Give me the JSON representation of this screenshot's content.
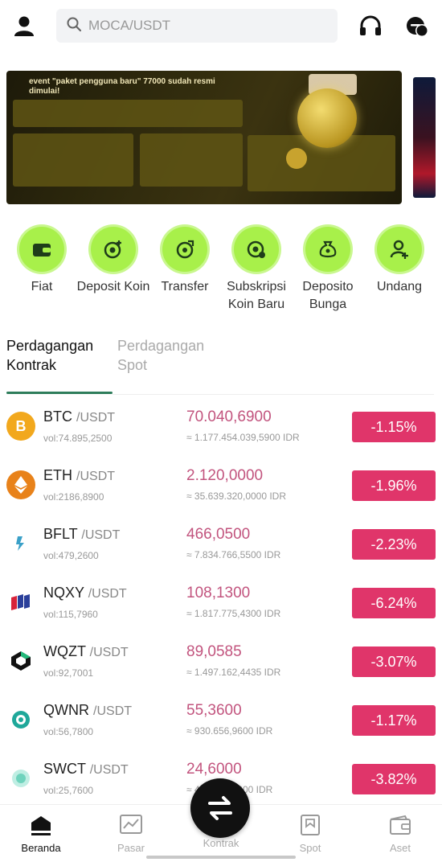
{
  "search": {
    "placeholder": "MOCA/USDT"
  },
  "banner": {
    "title": "event \"paket pengguna baru\" 77000 sudah resmi dimulai!"
  },
  "quick_actions": [
    {
      "label": "Fiat",
      "icon": "wallet-icon"
    },
    {
      "label": "Deposit Koin",
      "icon": "coin-deposit-icon"
    },
    {
      "label": "Transfer",
      "icon": "transfer-icon"
    },
    {
      "label": "Subskripsi Koin Baru",
      "icon": "subscribe-icon"
    },
    {
      "label": "Deposito Bunga",
      "icon": "money-bag-icon"
    },
    {
      "label": "Undang",
      "icon": "invite-user-icon"
    }
  ],
  "tabs": {
    "active": "Perdagangan Kontrak",
    "inactive": "Perdagangan Spot"
  },
  "markets": [
    {
      "base": "BTC",
      "quote": "/USDT",
      "vol": "vol:74.895,2500",
      "price": "70.040,6900",
      "idr": "≈ 1.177.454.039,5900 IDR",
      "change": "-1.15%",
      "icon_color": "#f2a81d",
      "icon_text": "B"
    },
    {
      "base": "ETH",
      "quote": "/USDT",
      "vol": "vol:2186,8900",
      "price": "2.120,0000",
      "idr": "≈ 35.639.320,0000 IDR",
      "change": "-1.96%",
      "icon_color": "#e8821a",
      "icon_text": "◆"
    },
    {
      "base": "BFLT",
      "quote": "/USDT",
      "vol": "vol:479,2600",
      "price": "466,0500",
      "idr": "≈ 7.834.766,5500 IDR",
      "change": "-2.23%",
      "icon_color": "#ffffff",
      "icon_text": ""
    },
    {
      "base": "NQXY",
      "quote": "/USDT",
      "vol": "vol:115,7960",
      "price": "108,1300",
      "idr": "≈ 1.817.775,4300 IDR",
      "change": "-6.24%",
      "icon_color": "#ffffff",
      "icon_text": ""
    },
    {
      "base": "WQZT",
      "quote": "/USDT",
      "vol": "vol:92,7001",
      "price": "89,0585",
      "idr": "≈ 1.497.162,4435 IDR",
      "change": "-3.07%",
      "icon_color": "#ffffff",
      "icon_text": ""
    },
    {
      "base": "QWNR",
      "quote": "/USDT",
      "vol": "vol:56,7800",
      "price": "55,3600",
      "idr": "≈ 930.656,9600 IDR",
      "change": "-1.17%",
      "icon_color": "#ffffff",
      "icon_text": ""
    },
    {
      "base": "SWCT",
      "quote": "/USDT",
      "vol": "vol:25,7600",
      "price": "24,6000",
      "idr": "≈ 413.550,6000 IDR",
      "change": "-3.82%",
      "icon_color": "#ffffff",
      "icon_text": ""
    }
  ],
  "nav": [
    {
      "label": "Beranda",
      "icon": "home-icon"
    },
    {
      "label": "Pasar",
      "icon": "market-chart-icon"
    },
    {
      "label": "Kontrak",
      "icon": "swap-icon"
    },
    {
      "label": "Spot",
      "icon": "spot-icon"
    },
    {
      "label": "Aset",
      "icon": "wallet-icon"
    }
  ],
  "colors": {
    "accent_green": "#a8f04a",
    "negative": "#e0356a",
    "price": "#c2547e"
  }
}
